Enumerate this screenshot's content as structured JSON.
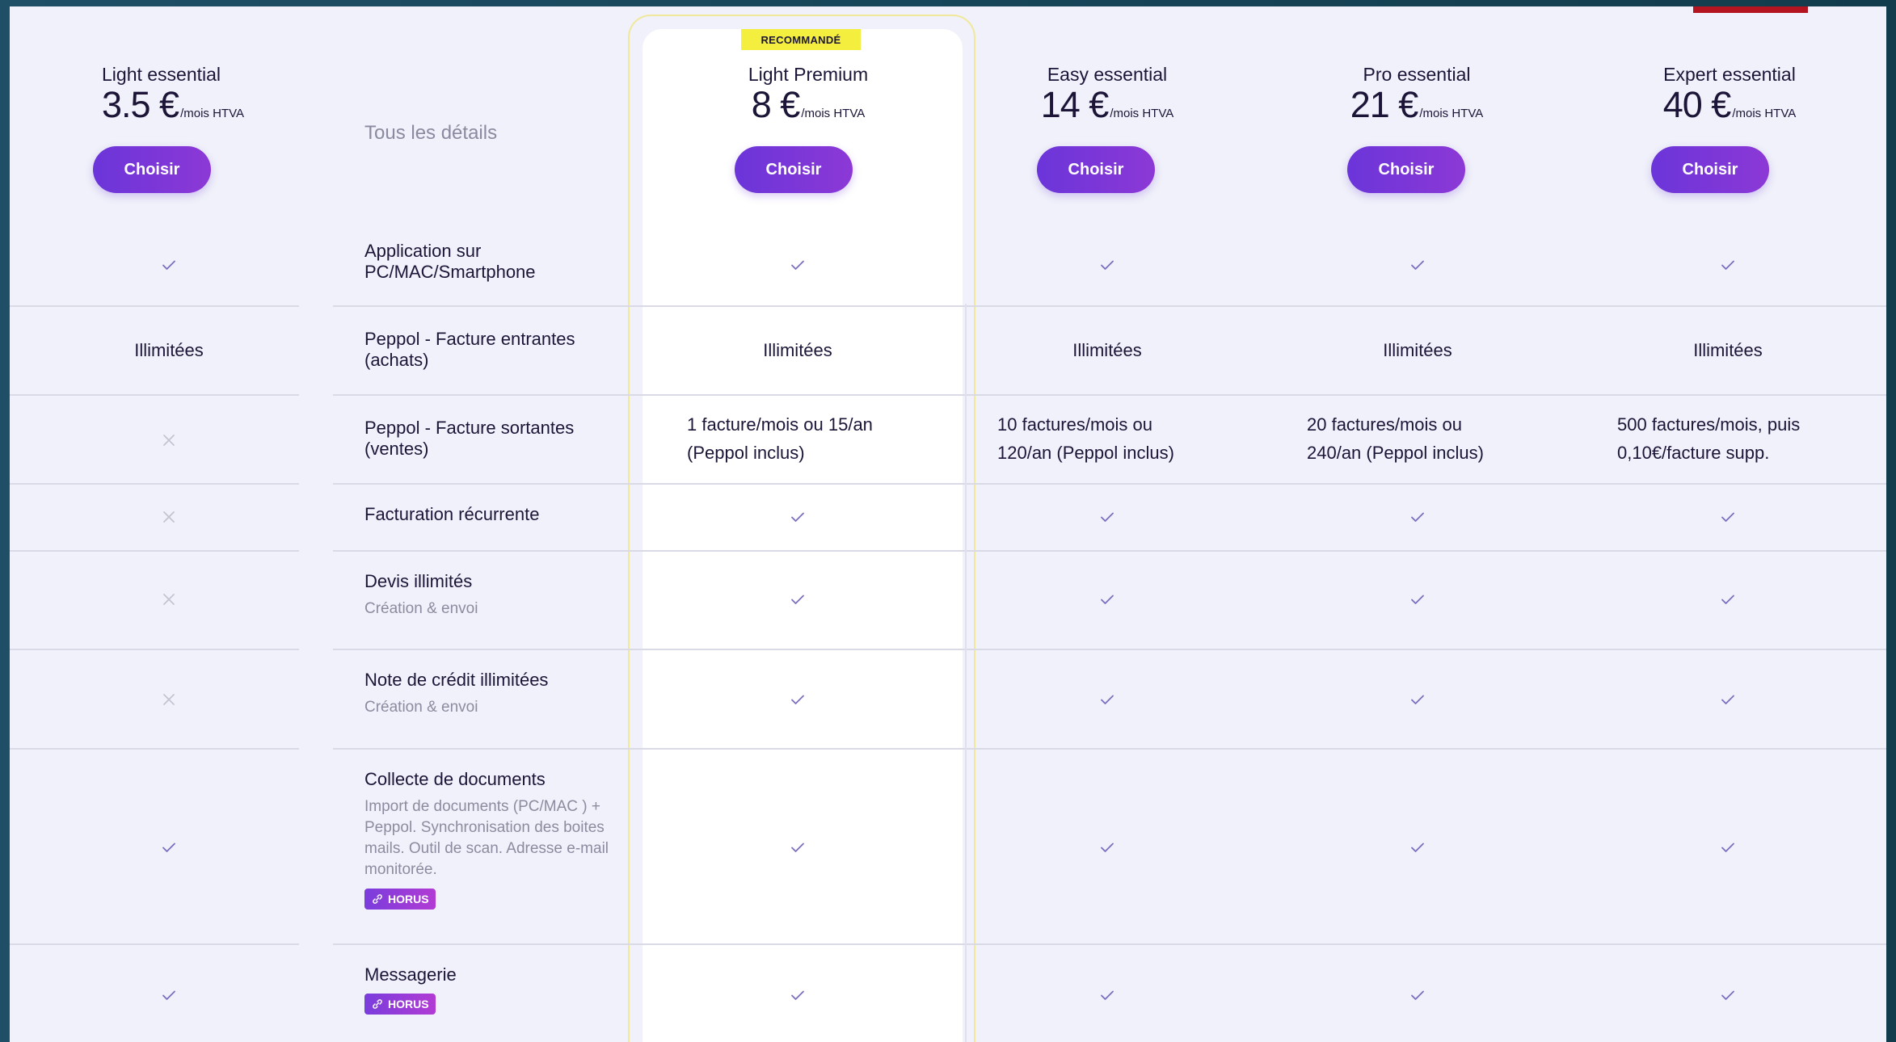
{
  "plans": [
    {
      "name": "Light essential",
      "amount": "3.5 €",
      "unit": "/mois HTVA",
      "button": "Choisir"
    },
    {
      "name": "Light Premium",
      "amount": "8 €",
      "unit": "/mois HTVA",
      "button": "Choisir",
      "badge": "RECOMMANDÉ"
    },
    {
      "name": "Easy essential",
      "amount": "14 €",
      "unit": "/mois HTVA",
      "button": "Choisir"
    },
    {
      "name": "Pro essential",
      "amount": "21 €",
      "unit": "/mois HTVA",
      "button": "Choisir"
    },
    {
      "name": "Expert essential",
      "amount": "40 €",
      "unit": "/mois HTVA",
      "button": "Choisir"
    }
  ],
  "details_heading": "Tous les détails",
  "horus_label": "HORUS",
  "features": [
    {
      "title": "Application sur PC/MAC/Smartphone",
      "values": [
        "check",
        "check",
        "check",
        "check",
        "check"
      ]
    },
    {
      "title": "Peppol - Facture entrantes (achats)",
      "values": [
        "Illimitées",
        "Illimitées",
        "Illimitées",
        "Illimitées",
        "Illimitées"
      ]
    },
    {
      "title": "Peppol - Facture sortantes (ventes)",
      "values": [
        "cross",
        "1 facture/mois ou 15/an (Peppol inclus)",
        "10 factures/mois ou 120/an (Peppol inclus)",
        "20 factures/mois ou 240/an (Peppol inclus)",
        "500 factures/mois, puis 0,10€/facture supp."
      ]
    },
    {
      "title": "Facturation récurrente",
      "values": [
        "cross",
        "check",
        "check",
        "check",
        "check"
      ]
    },
    {
      "title": "Devis illimités",
      "subtitle": "Création & envoi",
      "values": [
        "cross",
        "check",
        "check",
        "check",
        "check"
      ]
    },
    {
      "title": "Note de crédit illimitées",
      "subtitle": "Création & envoi",
      "values": [
        "cross",
        "check",
        "check",
        "check",
        "check"
      ]
    },
    {
      "title": "Collecte de documents",
      "subtitle": "Import de documents (PC/MAC ) + Peppol. Synchronisation des boites mails. Outil de scan. Adresse e-mail monitorée.",
      "badge": "HORUS",
      "values": [
        "check",
        "check",
        "check",
        "check",
        "check"
      ]
    },
    {
      "title": "Messagerie",
      "badge": "HORUS",
      "values": [
        "check",
        "check",
        "check",
        "check",
        "check"
      ]
    }
  ],
  "colors": {
    "accent": "#6b35d9",
    "badge": "#f4ef3e",
    "check": "#7b6fbf",
    "cross": "#c4c4d2",
    "text": "#1c1538"
  }
}
